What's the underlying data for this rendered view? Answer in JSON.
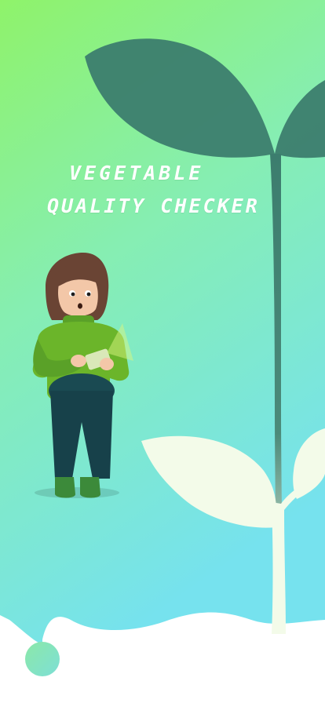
{
  "app": {
    "title_line1": "VEGETABLE",
    "title_line2": "QUALITY CHECKER"
  },
  "colors": {
    "gradient_top": "#8ff36a",
    "gradient_bottom": "#76e2ee",
    "plant_shadow": "#3c7d6e",
    "plant_light": "#f3fbe9",
    "white": "#ffffff"
  },
  "illustration": {
    "main": "person-holding-phone-illustration",
    "background": "plant-sprout-illustration"
  }
}
